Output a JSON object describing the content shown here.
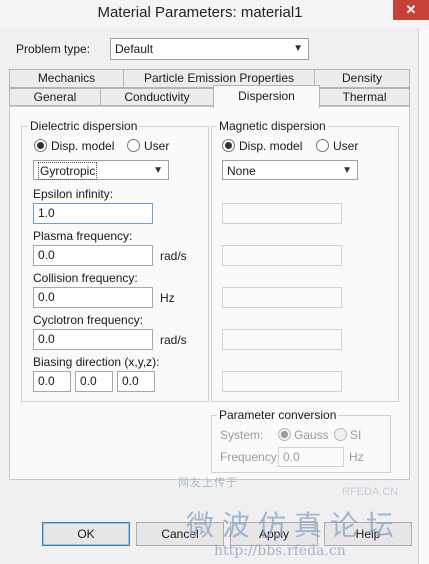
{
  "window": {
    "title": "Material Parameters: material1",
    "close_glyph": "✕"
  },
  "problem_type": {
    "label": "Problem type:",
    "value": "Default"
  },
  "tabs_row1": [
    "Mechanics",
    "Particle Emission Properties",
    "Density"
  ],
  "tabs_row2": [
    "General",
    "Conductivity",
    "Dispersion",
    "Thermal"
  ],
  "active_tab": "Dispersion",
  "dielectric": {
    "title": "Dielectric dispersion",
    "radio_model": "Disp. model",
    "radio_user": "User",
    "model_value": "Gyrotropic",
    "eps_label": "Epsilon infinity:",
    "eps_value": "1.0",
    "plasma_label": "Plasma frequency:",
    "plasma_value": "0.0",
    "plasma_unit": "rad/s",
    "collision_label": "Collision frequency:",
    "collision_value": "0.0",
    "collision_unit": "Hz",
    "cyclotron_label": "Cyclotron frequency:",
    "cyclotron_value": "0.0",
    "cyclotron_unit": "rad/s",
    "bias_label": "Biasing direction (x,y,z):",
    "bias_x": "0.0",
    "bias_y": "0.0",
    "bias_z": "0.0"
  },
  "magnetic": {
    "title": "Magnetic dispersion",
    "radio_model": "Disp. model",
    "radio_user": "User",
    "model_value": "None"
  },
  "conversion": {
    "title": "Parameter conversion",
    "system_label": "System:",
    "gauss": "Gauss",
    "si": "SI",
    "freq_label": "Frequency:",
    "freq_value": "0.0",
    "freq_unit": "Hz"
  },
  "buttons": {
    "ok": "OK",
    "cancel": "Cancel",
    "apply": "Apply",
    "help": "Help"
  },
  "watermark": {
    "cn_small": "网友上传于",
    "brand": "RFEDA.CN",
    "forum": "微波仿真论坛",
    "url": "http://bbs.rfeda.cn"
  }
}
